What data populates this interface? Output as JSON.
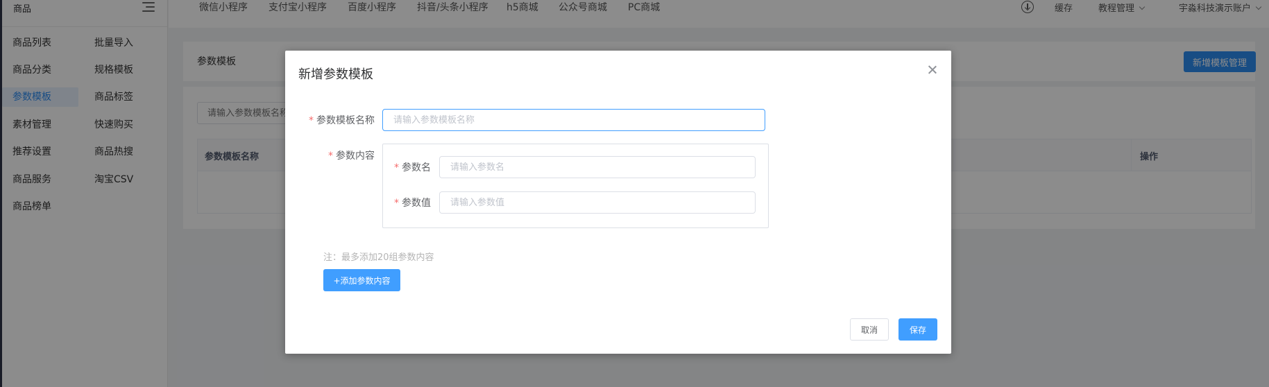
{
  "sidebar": {
    "title": "商品",
    "menu_icon": "hamburger-menu-icon",
    "items": [
      {
        "label": "商品列表",
        "active": false
      },
      {
        "label": "批量导入",
        "active": false
      },
      {
        "label": "商品分类",
        "active": false
      },
      {
        "label": "规格模板",
        "active": false
      },
      {
        "label": "参数模板",
        "active": true
      },
      {
        "label": "商品标签",
        "active": false
      },
      {
        "label": "素材管理",
        "active": false
      },
      {
        "label": "快速购买",
        "active": false
      },
      {
        "label": "推荐设置",
        "active": false
      },
      {
        "label": "商品热搜",
        "active": false
      },
      {
        "label": "商品服务",
        "active": false
      },
      {
        "label": "淘宝CSV",
        "active": false
      },
      {
        "label": "商品榜单",
        "active": false
      }
    ]
  },
  "topbar": {
    "nav": [
      "微信小程序",
      "支付宝小程序",
      "百度小程序",
      "抖音/头条小程序",
      "h5商城",
      "公众号商城",
      "PC商城"
    ],
    "download_icon": "download-circle-icon",
    "cache": "缓存",
    "tutorial": "教程管理",
    "account": "宇淼科技演示账户"
  },
  "page": {
    "title": "参数模板",
    "add_button": "新增模板管理",
    "search_placeholder": "请输入参数模板名称",
    "table_headers": [
      "参数模板名称",
      "操作"
    ]
  },
  "dialog": {
    "title": "新增参数模板",
    "close_icon": "close-icon",
    "name_label": "参数模板名称",
    "name_placeholder": "请输入参数模板名称",
    "content_label": "参数内容",
    "param_name_label": "参数名",
    "param_name_placeholder": "请输入参数名",
    "param_value_label": "参数值",
    "param_value_placeholder": "请输入参数值",
    "note": "注：最多添加20组参数内容",
    "add_content_button": "+添加参数内容",
    "cancel_button": "取消",
    "save_button": "保存"
  },
  "colors": {
    "primary": "#409eff",
    "required_star": "#f56c6c",
    "sidebar_active": "#2d8cf0"
  }
}
